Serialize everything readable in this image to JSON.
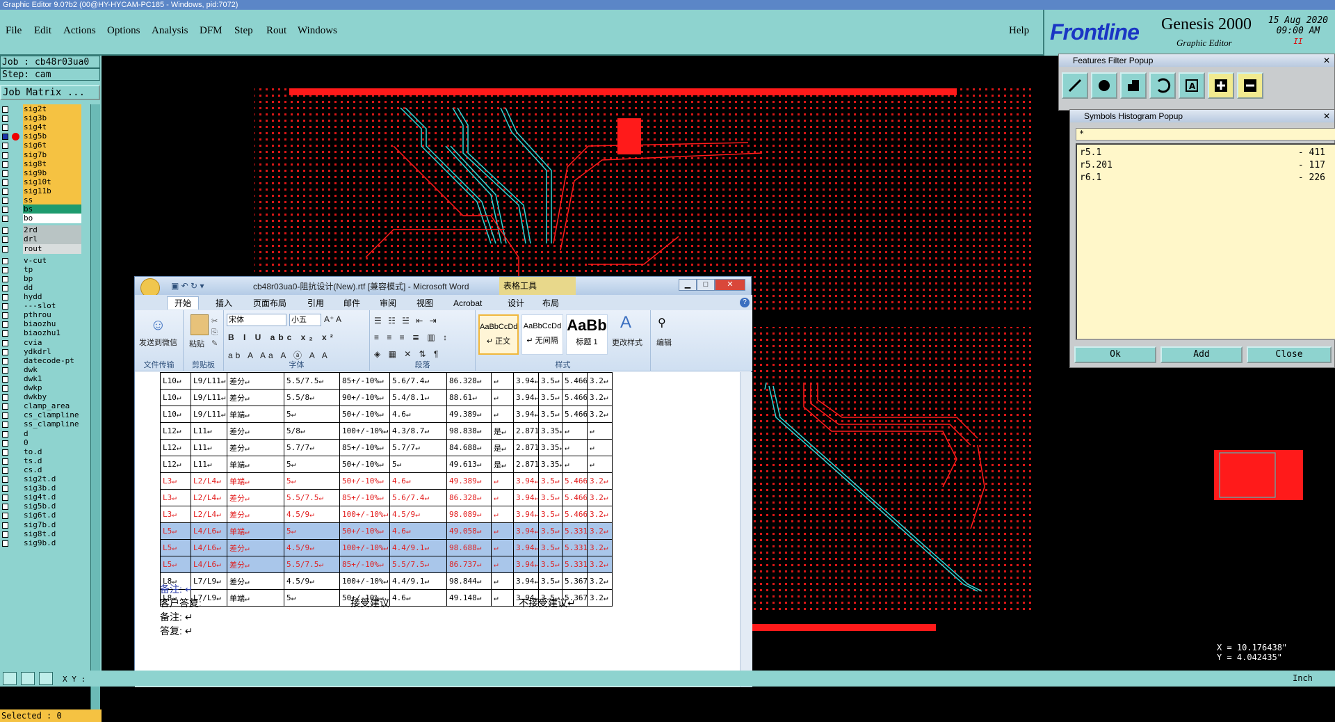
{
  "window_title": "Graphic Editor 9.0?b2 (00@HY-HYCAM-PC185 - Windows, pid:7072)",
  "menu": [
    "File",
    "Edit",
    "Actions",
    "Options",
    "Analysis",
    "DFM",
    "Step",
    "Rout",
    "Windows"
  ],
  "help_label": "Help",
  "brand": {
    "logo": "Frontline",
    "product": "Genesis 2000",
    "subtitle": "Graphic Editor",
    "date": "15 Aug 2020",
    "time": "09:00 AM",
    "pause": "II"
  },
  "job_label": "Job : cb48r03ua0",
  "step_label": "Step: cam",
  "job_matrix_label": "Job Matrix ...",
  "layers": [
    {
      "name": "sig2t",
      "color": "#f5c242"
    },
    {
      "name": "sig3b",
      "color": "#f5c242"
    },
    {
      "name": "sig4t",
      "color": "#f5c242"
    },
    {
      "name": "sig5b",
      "color": "#f5c242",
      "selected": true
    },
    {
      "name": "sig6t",
      "color": "#f5c242"
    },
    {
      "name": "sig7b",
      "color": "#f5c242"
    },
    {
      "name": "sig8t",
      "color": "#f5c242"
    },
    {
      "name": "sig9b",
      "color": "#f5c242"
    },
    {
      "name": "sig10t",
      "color": "#f5c242"
    },
    {
      "name": "sig11b",
      "color": "#f5c242"
    },
    {
      "name": "ss",
      "color": "#f5c242"
    },
    {
      "name": "bs",
      "color": "#1e9b6e"
    },
    {
      "name": "bo",
      "color": "#ffffff"
    },
    {
      "name": "2rd",
      "color": "#b9c4c4",
      "gap": true
    },
    {
      "name": "drl",
      "color": "#b9c4c4"
    },
    {
      "name": "rout",
      "color": "#d8dddd"
    },
    {
      "name": "v-cut",
      "color": "#8ed3cf",
      "gap": true
    },
    {
      "name": "tp",
      "color": "#8ed3cf"
    },
    {
      "name": "bp",
      "color": "#8ed3cf"
    },
    {
      "name": "dd",
      "color": "#8ed3cf"
    },
    {
      "name": "hydd",
      "color": "#8ed3cf"
    },
    {
      "name": "---slot",
      "color": "#8ed3cf"
    },
    {
      "name": "pthrou",
      "color": "#8ed3cf"
    },
    {
      "name": "biaozhu",
      "color": "#8ed3cf"
    },
    {
      "name": "biaozhu1",
      "color": "#8ed3cf"
    },
    {
      "name": "cvia",
      "color": "#8ed3cf"
    },
    {
      "name": "ydkdrl",
      "color": "#8ed3cf"
    },
    {
      "name": "datecode-pt",
      "color": "#8ed3cf"
    },
    {
      "name": "dwk",
      "color": "#8ed3cf"
    },
    {
      "name": "dwk1",
      "color": "#8ed3cf"
    },
    {
      "name": "dwkp",
      "color": "#8ed3cf"
    },
    {
      "name": "dwkby",
      "color": "#8ed3cf"
    },
    {
      "name": "clamp_area",
      "color": "#8ed3cf"
    },
    {
      "name": "cs_clampline",
      "color": "#8ed3cf"
    },
    {
      "name": "ss_clampline",
      "color": "#8ed3cf"
    },
    {
      "name": "d",
      "color": "#8ed3cf"
    },
    {
      "name": "0",
      "color": "#8ed3cf"
    },
    {
      "name": "to.d",
      "color": "#8ed3cf"
    },
    {
      "name": "ts.d",
      "color": "#8ed3cf"
    },
    {
      "name": "cs.d",
      "color": "#8ed3cf"
    },
    {
      "name": "sig2t.d",
      "color": "#8ed3cf"
    },
    {
      "name": "sig3b.d",
      "color": "#8ed3cf"
    },
    {
      "name": "sig4t.d",
      "color": "#8ed3cf"
    },
    {
      "name": "sig5b.d",
      "color": "#8ed3cf"
    },
    {
      "name": "sig6t.d",
      "color": "#8ed3cf"
    },
    {
      "name": "sig7b.d",
      "color": "#8ed3cf"
    },
    {
      "name": "sig8t.d",
      "color": "#8ed3cf"
    },
    {
      "name": "sig9b.d",
      "color": "#8ed3cf"
    }
  ],
  "selected_label": "Selected : 0",
  "xy_label": "X Y :",
  "features_filter": {
    "title": "Features Filter Popup",
    "tools": [
      "line-tool-icon",
      "pad-tool-icon",
      "surface-tool-icon",
      "arc-tool-icon",
      "text-tool-icon",
      "plus-icon",
      "minus-icon"
    ]
  },
  "symbols_histogram": {
    "title": "Symbols Histogram Popup",
    "filter": "*",
    "rows": [
      {
        "sym": "r5.1",
        "count": "- 411"
      },
      {
        "sym": "r5.201",
        "count": "- 117"
      },
      {
        "sym": "r6.1",
        "count": "- 226"
      }
    ],
    "ok": "Ok",
    "add": "Add",
    "close": "Close"
  },
  "word": {
    "title": "cb48r03ua0-阻抗设计(New).rtf [兼容模式] - Microsoft Word",
    "context_tab": "表格工具",
    "tabs": [
      "开始",
      "插入",
      "页面布局",
      "引用",
      "邮件",
      "审阅",
      "视图",
      "Acrobat",
      "设计",
      "布局"
    ],
    "ribbon": {
      "send_wechat": "发送到微信",
      "group_transfer": "文件传输",
      "paste": "粘贴",
      "group_clipboard": "剪贴板",
      "font_name": "宋体",
      "font_size": "小五",
      "group_font": "字体",
      "group_para": "段落",
      "styles": [
        {
          "sample": "AaBbCcDd",
          "name": "↵ 正文"
        },
        {
          "sample": "AaBbCcDd",
          "name": "↵ 无间隔"
        },
        {
          "sample": "AaBb",
          "name": "标题 1"
        }
      ],
      "change_styles": "更改样式",
      "group_styles": "样式",
      "edit": "编辑"
    },
    "table_rows": [
      {
        "cells": [
          "L10↵",
          "L9/L11↵",
          "差分↵",
          "5.5/7.5↵",
          "85+/-10%↵",
          "5.6/7.4↵",
          "86.328↵",
          "↵",
          "3.94↵",
          "3.5↵",
          "5.466↵",
          "3.2↵"
        ],
        "style": "normal"
      },
      {
        "cells": [
          "L10↵",
          "L9/L11↵",
          "差分↵",
          "5.5/8↵",
          "90+/-10%↵",
          "5.4/8.1↵",
          "88.61↵",
          "↵",
          "3.94↵",
          "3.5↵",
          "5.466↵",
          "3.2↵"
        ],
        "style": "normal"
      },
      {
        "cells": [
          "L10↵",
          "L9/L11↵",
          "单端↵",
          "5↵",
          "50+/-10%↵",
          "4.6↵",
          "49.389↵",
          "↵",
          "3.94↵",
          "3.5↵",
          "5.466↵",
          "3.2↵"
        ],
        "style": "normal"
      },
      {
        "cells": [
          "L12↵",
          "L11↵",
          "差分↵",
          "5/8↵",
          "100+/-10%↵",
          "4.3/8.7↵",
          "98.838↵",
          "是↵",
          "2.871↵",
          "3.35↵",
          "↵",
          "↵"
        ],
        "style": "normal"
      },
      {
        "cells": [
          "L12↵",
          "L11↵",
          "差分↵",
          "5.7/7↵",
          "85+/-10%↵",
          "5.7/7↵",
          "84.688↵",
          "是↵",
          "2.871↵",
          "3.35↵",
          "↵",
          "↵"
        ],
        "style": "normal"
      },
      {
        "cells": [
          "L12↵",
          "L11↵",
          "单端↵",
          "5↵",
          "50+/-10%↵",
          "5↵",
          "49.613↵",
          "是↵",
          "2.871↵",
          "3.35↵",
          "↵",
          "↵"
        ],
        "style": "normal"
      },
      {
        "cells": [
          "L3↵",
          "L2/L4↵",
          "单端↵",
          "5↵",
          "50+/-10%↵",
          "4.6↵",
          "49.389↵",
          "↵",
          "3.94↵",
          "3.5↵",
          "5.466↵",
          "3.2↵"
        ],
        "style": "red"
      },
      {
        "cells": [
          "L3↵",
          "L2/L4↵",
          "差分↵",
          "5.5/7.5↵",
          "85+/-10%↵",
          "5.6/7.4↵",
          "86.328↵",
          "↵",
          "3.94↵",
          "3.5↵",
          "5.466↵",
          "3.2↵"
        ],
        "style": "red"
      },
      {
        "cells": [
          "L3↵",
          "L2/L4↵",
          "差分↵",
          "4.5/9↵",
          "100+/-10%↵",
          "4.5/9↵",
          "98.089↵",
          "↵",
          "3.94↵",
          "3.5↵",
          "5.466↵",
          "3.2↵"
        ],
        "style": "red"
      },
      {
        "cells": [
          "L5↵",
          "L4/L6↵",
          "单端↵",
          "5↵",
          "50+/-10%↵",
          "4.6↵",
          "49.058↵",
          "↵",
          "3.94↵",
          "3.5↵",
          "5.331↵",
          "3.2↵"
        ],
        "style": "hl"
      },
      {
        "cells": [
          "L5↵",
          "L4/L6↵",
          "差分↵",
          "4.5/9↵",
          "100+/-10%↵",
          "4.4/9.1↵",
          "98.688↵",
          "↵",
          "3.94↵",
          "3.5↵",
          "5.331↵",
          "3.2↵"
        ],
        "style": "hl"
      },
      {
        "cells": [
          "L5↵",
          "L4/L6↵",
          "差分↵",
          "5.5/7.5↵",
          "85+/-10%↵",
          "5.5/7.5↵",
          "86.737↵",
          "↵",
          "3.94↵",
          "3.5↵",
          "5.331↵",
          "3.2↵"
        ],
        "style": "hl"
      },
      {
        "cells": [
          "L8↵",
          "L7/L9↵",
          "差分↵",
          "4.5/9↵",
          "100+/-10%↵",
          "4.4/9.1↵",
          "98.844↵",
          "↵",
          "3.94↵",
          "3.5↵",
          "5.367↵",
          "3.2↵"
        ],
        "style": "normal"
      },
      {
        "cells": [
          "L8↵",
          "L7/L9↵",
          "单端↵",
          "5↵",
          "50+/-10%↵",
          "4.6↵",
          "49.148↵",
          "↵",
          "3.94↵",
          "3.5↵",
          "5.367↵",
          "3.2↵"
        ],
        "style": "normal"
      }
    ],
    "notes": {
      "note1": "备注: ↵",
      "customer_reply": "客户答复:",
      "accept": "接受建议",
      "reject": "不接受建议↵",
      "note2": "备注: ↵",
      "reply2": "答复: ↵"
    }
  },
  "coords": {
    "x": "X = 10.176438\"",
    "y": "Y = 4.042435\""
  },
  "unit": "Inch",
  "colors": {
    "panel": "#8ed3cf",
    "layer_active": "#f5c242",
    "board_red": "#ff1a1a",
    "trace_cyan": "#2fd6d6"
  }
}
